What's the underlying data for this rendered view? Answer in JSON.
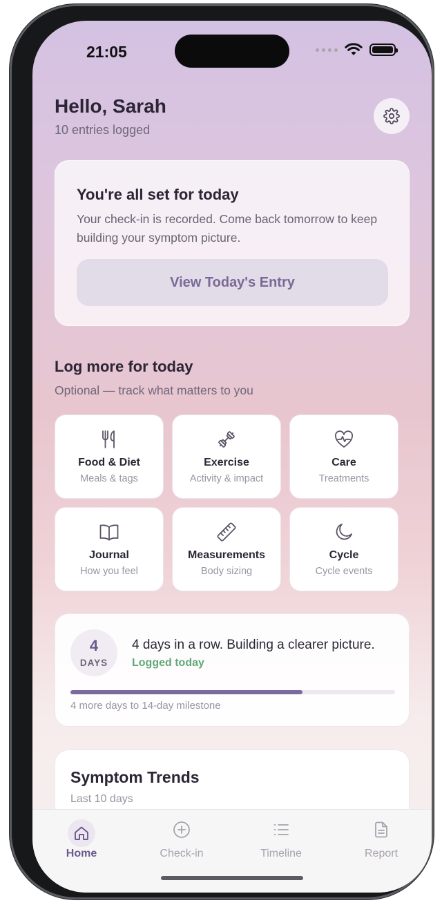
{
  "status_bar": {
    "time": "21:05"
  },
  "header": {
    "greeting": "Hello, Sarah",
    "entries_logged": "10 entries logged"
  },
  "checkin_card": {
    "title": "You're all set for today",
    "message": "Your check-in is recorded. Come back tomorrow to keep building your symptom picture.",
    "button_label": "View Today's Entry"
  },
  "log_more": {
    "title": "Log more for today",
    "subtitle": "Optional — track what matters to you",
    "tiles": [
      {
        "label": "Food & Diet",
        "sub": "Meals & tags",
        "icon": "fork-knife-icon"
      },
      {
        "label": "Exercise",
        "sub": "Activity & impact",
        "icon": "dumbbell-icon"
      },
      {
        "label": "Care",
        "sub": "Treatments",
        "icon": "heart-pulse-icon"
      },
      {
        "label": "Journal",
        "sub": "How you feel",
        "icon": "book-icon"
      },
      {
        "label": "Measurements",
        "sub": "Body sizing",
        "icon": "ruler-icon"
      },
      {
        "label": "Cycle",
        "sub": "Cycle events",
        "icon": "moon-icon"
      }
    ]
  },
  "streak": {
    "days": "4",
    "days_unit": "DAYS",
    "headline": "4 days in a row. Building a clearer picture.",
    "status": "Logged today",
    "progress": 0.714,
    "milestone": "4 more days to 14-day milestone"
  },
  "trends": {
    "title": "Symptom Trends",
    "subtitle": "Last 10 days"
  },
  "tabbar": {
    "tabs": [
      {
        "label": "Home",
        "icon": "home-icon",
        "active": true
      },
      {
        "label": "Check-in",
        "icon": "plus-circle-icon",
        "active": false
      },
      {
        "label": "Timeline",
        "icon": "list-icon",
        "active": false
      },
      {
        "label": "Report",
        "icon": "document-icon",
        "active": false
      }
    ]
  },
  "colors": {
    "accent": "#6b5a8e",
    "success": "#5fa878",
    "progress": "#7b6a9e"
  }
}
